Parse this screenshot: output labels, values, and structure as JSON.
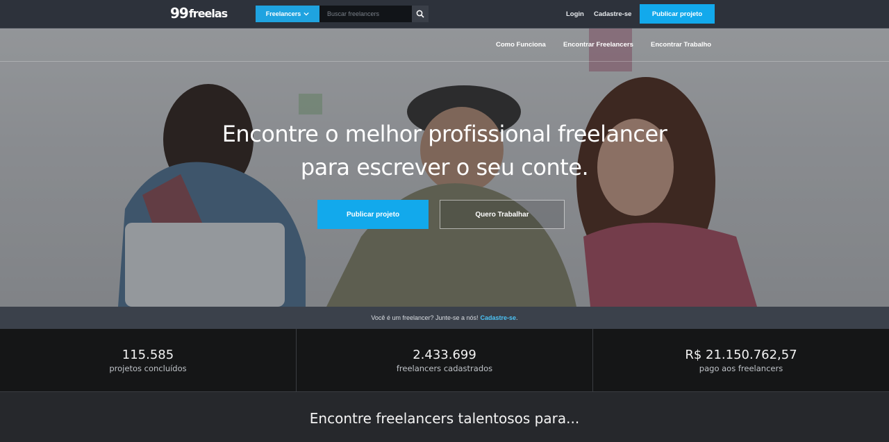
{
  "logo": {
    "number": "99",
    "word": "freelas"
  },
  "search": {
    "category": "Freelancers",
    "placeholder": "Buscar freelancers"
  },
  "header": {
    "login": "Login",
    "signup": "Cadastre-se",
    "publish": "Publicar projeto"
  },
  "subnav": {
    "items": [
      "Como Funciona",
      "Encontrar Freelancers",
      "Encontrar Trabalho"
    ]
  },
  "hero": {
    "line1": "Encontre o melhor profissional freelancer",
    "line2": "para escrever o seu conte.",
    "primary_btn": "Publicar projeto",
    "secondary_btn": "Quero Trabalhar"
  },
  "join": {
    "text": "Você é um freelancer? Junte-se a nós!",
    "link": "Cadastre-se",
    "end": "."
  },
  "stats": [
    {
      "value": "115.585",
      "label": "projetos concluídos"
    },
    {
      "value": "2.433.699",
      "label": "freelancers cadastrados"
    },
    {
      "value": "R$ 21.150.762,57",
      "label": "pago aos freelancers"
    }
  ],
  "section": {
    "title": "Encontre freelancers talentosos para..."
  },
  "colors": {
    "accent": "#12a9ec",
    "topbar": "#2d323b",
    "stats_bg": "#151617"
  },
  "icons": [
    "chevron-down-icon",
    "search-icon"
  ]
}
